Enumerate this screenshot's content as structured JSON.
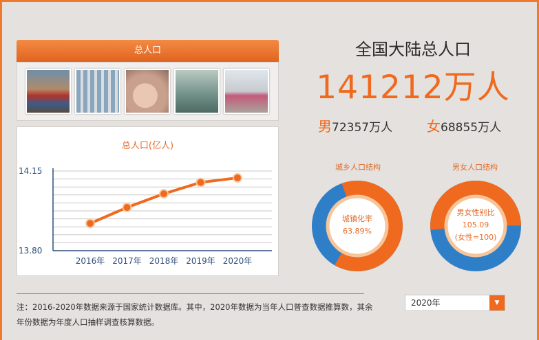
{
  "banner": {
    "title": "总人口"
  },
  "photos": [
    "天安门人群",
    "工厂车间",
    "新生婴儿",
    "医院产房",
    "儿童奔跑"
  ],
  "headline": "全国大陆总人口",
  "total": "141212万人",
  "male": {
    "label": "男",
    "value": "72357万人"
  },
  "female": {
    "label": "女",
    "value": "68855万人"
  },
  "urban": {
    "title": "城乡人口结构",
    "line1": "城镇化率",
    "line2": "63.89%",
    "fraction": 0.6389
  },
  "gender": {
    "title": "男女人口结构",
    "line1": "男女性别比",
    "line2": "105.09",
    "line3": "(女性=100)",
    "fraction": 0.5124
  },
  "note": "注：2016-2020年数据来源于国家统计数据库。其中，2020年数据为当年人口普查数据推算数，其余年份数据为年度人口抽样调查核算数据。",
  "year_select": {
    "value": "2020年",
    "arrow": "▼"
  },
  "colors": {
    "accent": "#ef6a1e",
    "blue": "#2f7fc8",
    "light_orange": "#f7c59a"
  },
  "chart_data": {
    "type": "line",
    "title": "总人口(亿人)",
    "categories": [
      "2016年",
      "2017年",
      "2018年",
      "2019年",
      "2020年"
    ],
    "values": [
      13.92,
      13.99,
      14.05,
      14.1,
      14.12
    ],
    "ylim": [
      13.8,
      14.15
    ],
    "yticks": [
      "14.15",
      "13.80"
    ],
    "grid": true
  }
}
